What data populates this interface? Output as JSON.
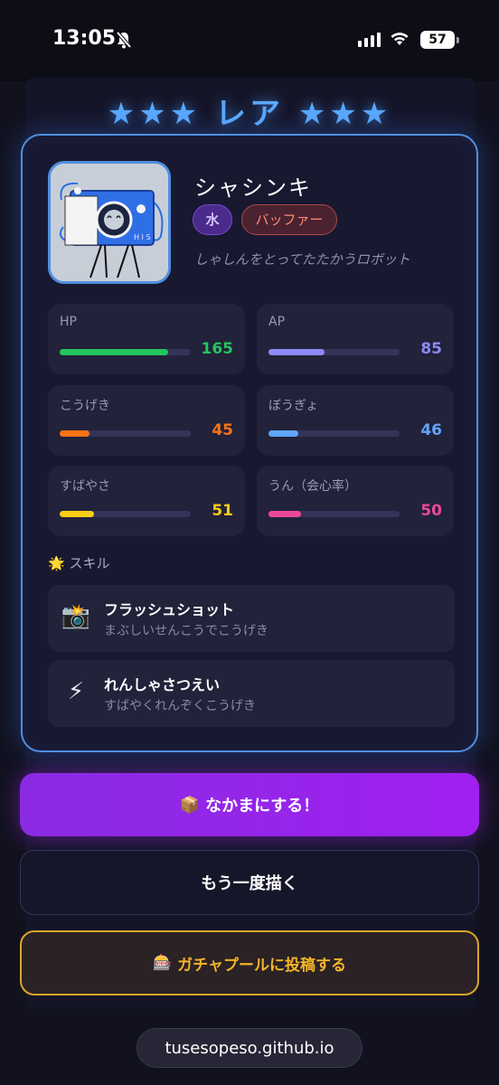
{
  "status_bar": {
    "time": "13:05",
    "battery": "57"
  },
  "card": {
    "rarity": "★★★ レア ★★★",
    "name": "シャシンキ",
    "element_badge": "水",
    "role_badge": "バッファー",
    "description": "しゃしんをとってたたかうロボット",
    "portrait_icon": "camera-robot-drawing",
    "stats": [
      {
        "label": "HP",
        "value": "165",
        "fill_percent": 83,
        "color": "#22c55e"
      },
      {
        "label": "AP",
        "value": "85",
        "fill_percent": 43,
        "color": "#8b8bf5"
      },
      {
        "label": "こうげき",
        "value": "45",
        "fill_percent": 23,
        "color": "#f97316"
      },
      {
        "label": "ぼうぎょ",
        "value": "46",
        "fill_percent": 23,
        "color": "#60a5fa"
      },
      {
        "label": "すばやさ",
        "value": "51",
        "fill_percent": 26,
        "color": "#facc15"
      },
      {
        "label": "うん（会心率）",
        "value": "50",
        "fill_percent": 25,
        "color": "#ec4899"
      }
    ],
    "skills_heading": "スキル",
    "skills_icon": "sparkle-star",
    "skills": [
      {
        "icon": "📸",
        "icon_name": "camera-flash-icon",
        "name": "フラッシュショット",
        "desc": "まぶしいせんこうでこうげき"
      },
      {
        "icon": "⚡",
        "icon_name": "lightning-icon",
        "name": "れんしゃさつえい",
        "desc": "すばやくれんぞくこうげき"
      }
    ]
  },
  "actions": {
    "join_icon": "📦",
    "join_label": "なかまにする！",
    "redraw_label": "もう一度描く",
    "post_icon": "🎰",
    "post_label": "ガチャプールに投稿する"
  },
  "footer": {
    "url": "tusesopeso.github.io"
  }
}
